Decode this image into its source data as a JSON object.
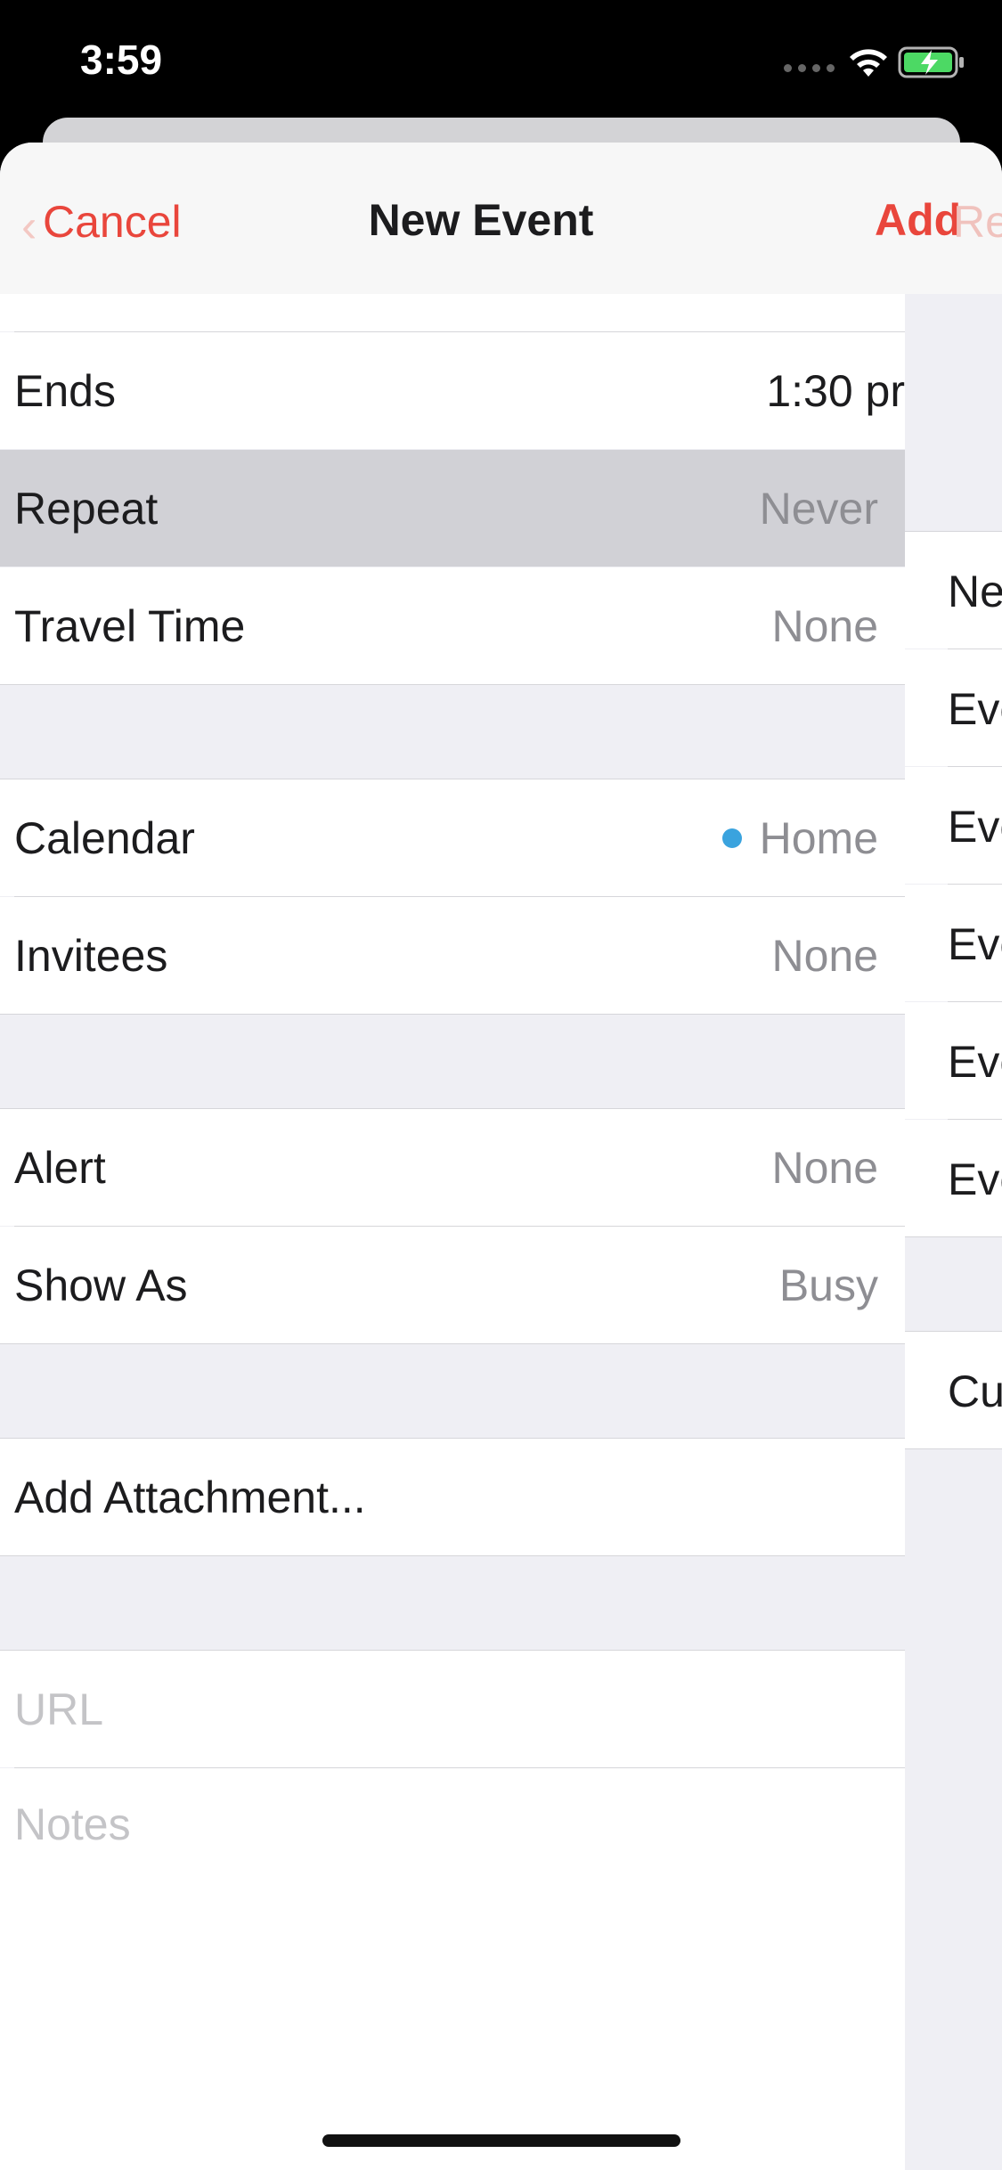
{
  "status_bar": {
    "time": "3:59"
  },
  "nav": {
    "cancel_label": "Cancel",
    "title": "New Event",
    "add_label": "Add",
    "ghost_label": "Re"
  },
  "rows": {
    "ends": {
      "label": "Ends",
      "value": "1:30 pr"
    },
    "repeat": {
      "label": "Repeat",
      "value": "Never"
    },
    "travel_time": {
      "label": "Travel Time",
      "value": "None"
    },
    "calendar": {
      "label": "Calendar",
      "value": "Home",
      "dot_color": "#3aa3de"
    },
    "invitees": {
      "label": "Invitees",
      "value": "None"
    },
    "alert": {
      "label": "Alert",
      "value": "None"
    },
    "show_as": {
      "label": "Show As",
      "value": "Busy"
    },
    "add_attachment": {
      "label": "Add Attachment..."
    },
    "url": {
      "placeholder": "URL"
    },
    "notes": {
      "placeholder": "Notes"
    }
  },
  "repeat_options": [
    "Ne",
    "Eve",
    "Eve",
    "Eve",
    "Eve",
    "Eve"
  ],
  "repeat_custom": "Cu",
  "colors": {
    "accent": "#e9463c",
    "highlight": "#d1d1d6"
  }
}
